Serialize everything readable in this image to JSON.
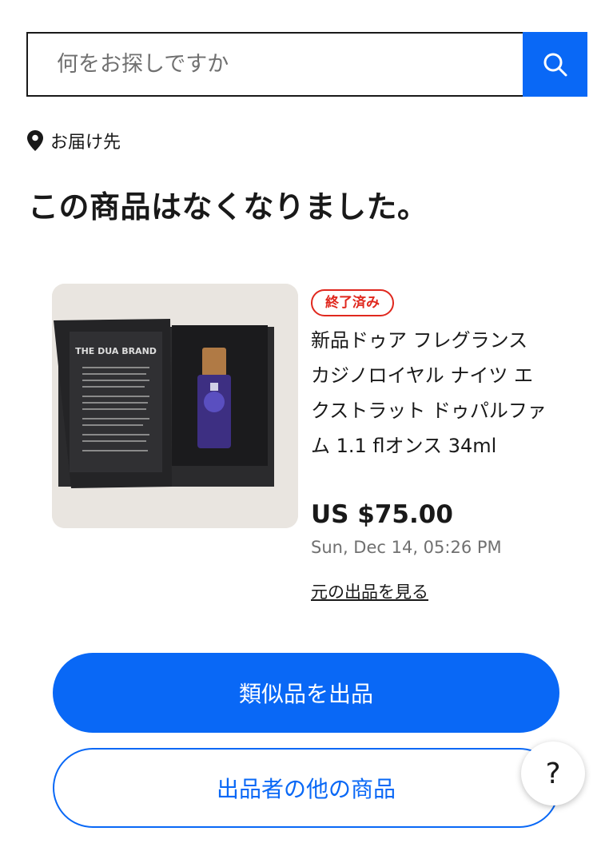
{
  "search": {
    "placeholder": "何をお探しですか",
    "button_icon": "search-icon"
  },
  "ship_to": {
    "icon": "map-pin-icon",
    "label": "お届け先"
  },
  "headline": "この商品はなくなりました。",
  "listing": {
    "status_badge": "終了済み",
    "title": "新品ドゥア フレグランス カジノロイヤル ナイツ エクストラット ドゥパルファム 1.1 flオンス 34ml",
    "price": "US $75.00",
    "end_date": "Sun, Dec 14, 05:26 PM",
    "view_original_label": "元の出品を見る",
    "image_box_text": "THE DUA BRAND"
  },
  "actions": {
    "sell_similar_label": "類似品を出品",
    "seller_other_items_label": "出品者の他の商品"
  },
  "help": {
    "label": "?"
  },
  "colors": {
    "accent": "#0968f6",
    "ended_badge": "#e0281e",
    "text_primary": "#191919",
    "text_secondary": "#707070"
  }
}
